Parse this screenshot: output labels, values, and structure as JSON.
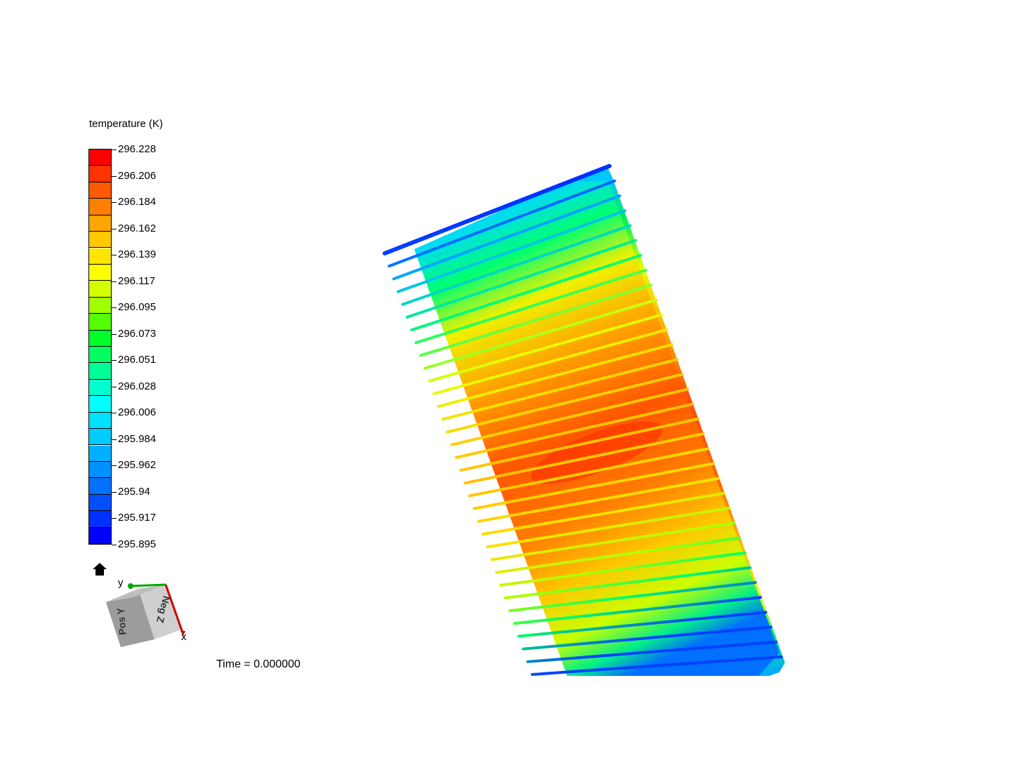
{
  "legend": {
    "title": "temperature (K)",
    "ticks": [
      "296.228",
      "296.206",
      "296.184",
      "296.162",
      "296.139",
      "296.117",
      "296.095",
      "296.073",
      "296.051",
      "296.028",
      "296.006",
      "295.984",
      "295.962",
      "295.94",
      "295.917",
      "295.895"
    ],
    "colors": [
      "#ff0000",
      "#ff3300",
      "#ff5a00",
      "#ff8000",
      "#ffa500",
      "#ffc800",
      "#ffe600",
      "#ffff00",
      "#d4ff00",
      "#a0ff00",
      "#55ff00",
      "#00ff2a",
      "#00ff60",
      "#00ff99",
      "#00ffcc",
      "#00ffff",
      "#00e0ff",
      "#00ccff",
      "#00b0ff",
      "#0090ff",
      "#0070ff",
      "#0050ff",
      "#0030ff",
      "#0000ff"
    ]
  },
  "orientation_widget": {
    "face_left": "Pos Y",
    "face_right": "Neg Z",
    "axis_y": "y",
    "axis_x": "x",
    "colors": {
      "x": "#cc0000",
      "y": "#00aa00",
      "cube_left": "#9c9c9c",
      "cube_right": "#cfcfcf"
    }
  },
  "status": {
    "time": "Time = 0.000000"
  },
  "icons": {
    "home": "home-icon"
  }
}
